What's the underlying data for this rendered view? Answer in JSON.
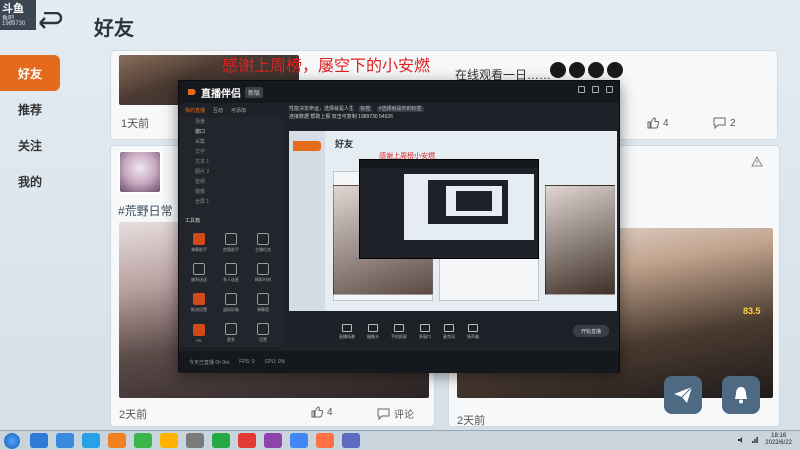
{
  "app": {
    "logo_text": "斗鱼",
    "logo_sub": "鱼吧",
    "logo_num": "1989730",
    "title": "好友",
    "nav": [
      {
        "label": "好友",
        "active": true
      },
      {
        "label": "推荐",
        "active": false
      },
      {
        "label": "关注",
        "active": false
      },
      {
        "label": "我的",
        "active": false
      }
    ]
  },
  "overlay": {
    "title": "感谢上周榜，屡空下的小安燃",
    "subtitle": "在线观看一日……"
  },
  "feed": {
    "top_card": {
      "time": "1天前",
      "likes": "4",
      "comments": "2"
    },
    "left_card": {
      "hashtag": "#荒野日常",
      "time": "2天前",
      "likes": "4",
      "comment_label": "评论"
    },
    "right_card": {
      "time": "2天前",
      "score": "83.5"
    }
  },
  "stream_window": {
    "app_name": "直播伴侣",
    "version": "新版",
    "tabs": [
      "我的直播",
      "互动",
      "可添加"
    ],
    "info_line1": "性能决定命运，选择就是人生",
    "info_badge1": "标签",
    "info_badge2": "#选择就是你的标签",
    "info_line2": "连接数据  帮助上报  双击可复制",
    "info_num": "1989730",
    "info_num2": "54626",
    "scenes": [
      "场景",
      "窗口",
      "采集",
      "文字",
      "文本 1",
      "图片 2",
      "音频",
      "摄像",
      "全屏 1"
    ],
    "tools_header": "工具箱",
    "tools": [
      "弹幕助手",
      "房管助手",
      "主播任务",
      "福利送送",
      "多人连麦",
      "精彩时刻",
      "推流设置",
      "虚拟形象",
      "弹幕墙",
      "PK",
      "更多",
      "设置"
    ],
    "bottom_buttons": [
      "直播场景",
      "摄像头",
      "手机投屏",
      "多窗口",
      "麦克风",
      "扬声器"
    ],
    "start_label": "开始直播",
    "status": "今天已直播 0h 0m",
    "status_fps": "FPS: 0",
    "status_cpu": "CPU: 0%",
    "nested_title": "好友",
    "nested_overlay": "感谢上周榜小安燃"
  },
  "taskbar": {
    "time": "18:16",
    "date": "2022/6/22",
    "icon_colors": [
      "#2d7bd6",
      "#3b8ae0",
      "#28a0e8",
      "#f08020",
      "#39b54a",
      "#ffb300",
      "#7a7a7a",
      "#26a844",
      "#e53935",
      "#8e44ad",
      "#4285f4",
      "#ff7043",
      "#5c6bc0"
    ]
  }
}
